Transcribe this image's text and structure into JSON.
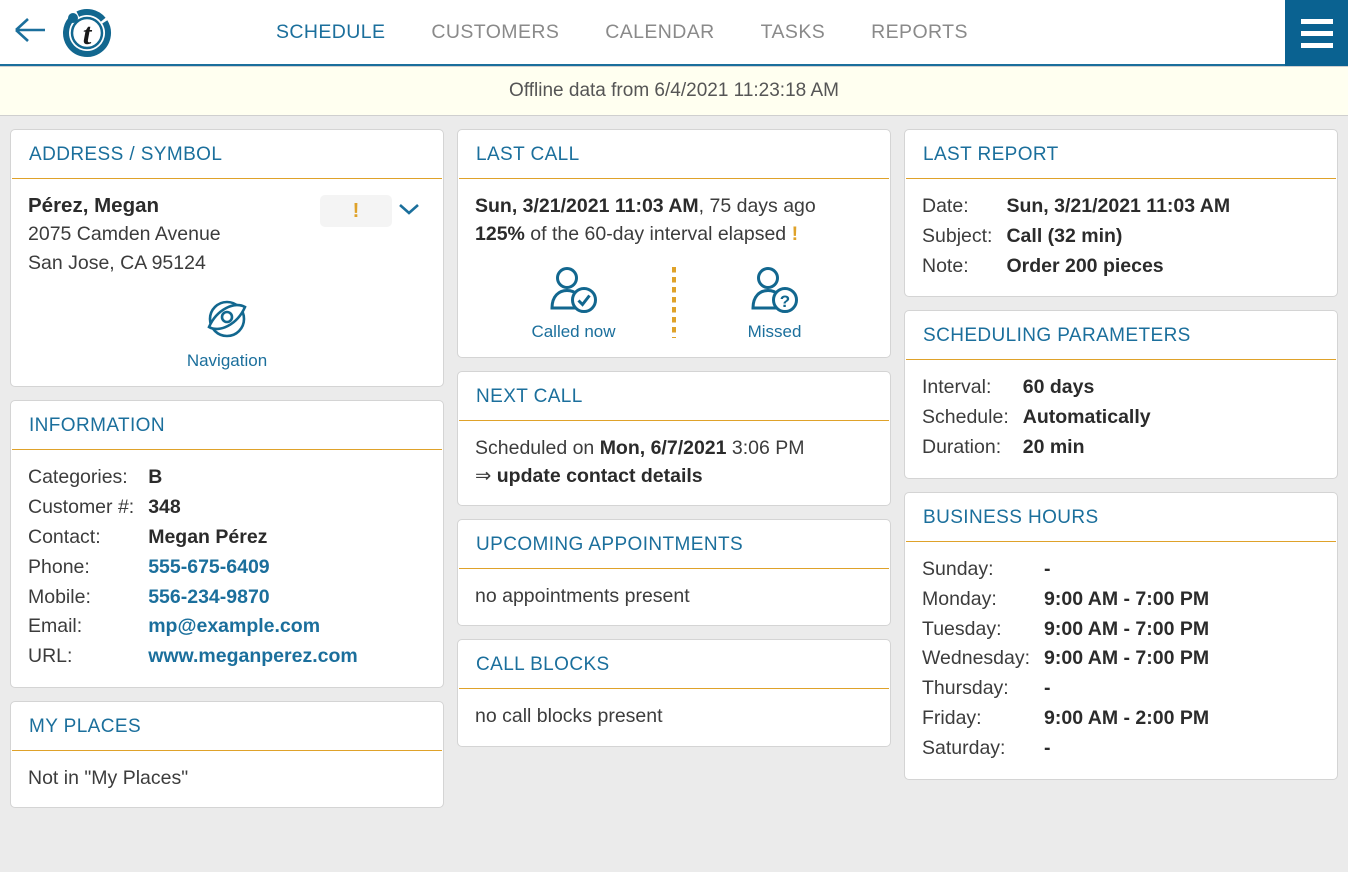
{
  "nav": {
    "back_icon": "arrow-left-icon",
    "logo_letter": "t",
    "menu_icon": "hamburger-menu-icon",
    "links": [
      {
        "label": "SCHEDULE",
        "active": true
      },
      {
        "label": "CUSTOMERS",
        "active": false
      },
      {
        "label": "CALENDAR",
        "active": false
      },
      {
        "label": "TASKS",
        "active": false
      },
      {
        "label": "REPORTS",
        "active": false
      }
    ]
  },
  "banner": {
    "text": "Offline data from 6/4/2021 11:23:18 AM"
  },
  "colors": {
    "accent_blue": "#1b6f9c",
    "menu_blue": "#0a6291",
    "underline_orange": "#dfa22a",
    "page_bg": "#ebebeb",
    "banner_bg": "#fffff0"
  },
  "address_card": {
    "title": "ADDRESS / SYMBOL",
    "customer_name": "Pérez, Megan",
    "street": "2075 Camden Avenue",
    "city_state_zip": "San Jose, CA 95124",
    "symbol_badge": "!",
    "expand_icon": "chevron-down-icon",
    "navigation_icon": "navigation-eye-icon",
    "navigation_label": "Navigation"
  },
  "information_card": {
    "title": "INFORMATION",
    "rows": [
      {
        "key": "Categories:",
        "value": "B",
        "link": false
      },
      {
        "key": "Customer #:",
        "value": "348",
        "link": false
      },
      {
        "key": "Contact:",
        "value": "Megan Pérez",
        "link": false
      },
      {
        "key": "Phone:",
        "value": "555-675-6409",
        "link": true
      },
      {
        "key": "Mobile:",
        "value": "556-234-9870",
        "link": true
      },
      {
        "key": "Email:",
        "value": "mp@example.com",
        "link": true
      },
      {
        "key": "URL:",
        "value": "www.meganperez.com",
        "link": true
      }
    ]
  },
  "my_places_card": {
    "title": "MY PLACES",
    "text": "Not in \"My Places\""
  },
  "last_call_card": {
    "title": "LAST CALL",
    "datetime": "Sun, 3/21/2021 11:03 AM",
    "ago": ", 75 days ago",
    "percent": "125%",
    "interval_text": "of the 60-day interval elapsed",
    "warn_mark": "!",
    "actions": [
      {
        "label": "Called now",
        "icon": "person-check-icon"
      },
      {
        "label": "Missed",
        "icon": "person-question-icon"
      }
    ]
  },
  "next_call_card": {
    "title": "NEXT CALL",
    "prefix": "Scheduled on ",
    "date": "Mon, 6/7/2021",
    "time": " 3:06 PM",
    "arrow": "⇒",
    "note": "update contact details"
  },
  "upcoming_card": {
    "title": "UPCOMING APPOINTMENTS",
    "text": "no appointments present"
  },
  "call_blocks_card": {
    "title": "CALL BLOCKS",
    "text": "no call blocks present"
  },
  "last_report_card": {
    "title": "LAST REPORT",
    "rows": [
      {
        "key": "Date:",
        "value": "Sun, 3/21/2021 11:03 AM"
      },
      {
        "key": "Subject:",
        "value": "Call (32 min)"
      },
      {
        "key": "Note:",
        "value": "Order 200 pieces"
      }
    ]
  },
  "scheduling_card": {
    "title": "SCHEDULING PARAMETERS",
    "rows": [
      {
        "key": "Interval:",
        "value": "60 days"
      },
      {
        "key": "Schedule:",
        "value": "Automatically"
      },
      {
        "key": "Duration:",
        "value": "20 min"
      }
    ]
  },
  "business_hours_card": {
    "title": "BUSINESS HOURS",
    "rows": [
      {
        "key": "Sunday:",
        "value": "-"
      },
      {
        "key": "Monday:",
        "value": "9:00 AM - 7:00 PM"
      },
      {
        "key": "Tuesday:",
        "value": "9:00 AM - 7:00 PM"
      },
      {
        "key": "Wednesday:",
        "value": "9:00 AM - 7:00 PM"
      },
      {
        "key": "Thursday:",
        "value": "-"
      },
      {
        "key": "Friday:",
        "value": "9:00 AM - 2:00 PM"
      },
      {
        "key": "Saturday:",
        "value": "-"
      }
    ]
  }
}
